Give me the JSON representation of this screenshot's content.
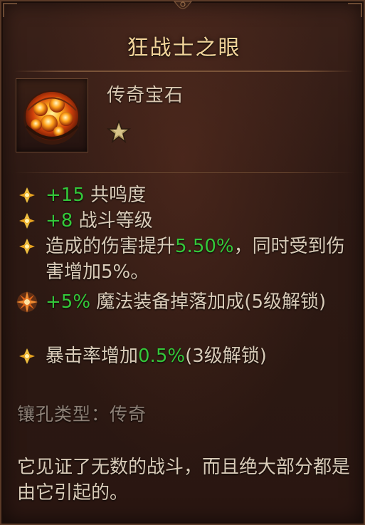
{
  "item": {
    "name": "狂战士之眼",
    "type": "传奇宝石",
    "rank_icon": "star-icon",
    "image_icon": "legendary-gem-icon"
  },
  "properties": [
    {
      "prefix": "+15",
      "text": " 共鸣度",
      "rest": "",
      "suffix": "",
      "bullet": "gold-diamond-icon"
    },
    {
      "prefix": "+8",
      "text": " 战斗等级",
      "rest": "",
      "suffix": "",
      "bullet": "gold-diamond-icon"
    },
    {
      "prefix": "",
      "text": "造成的伤害提升",
      "highlight": "5.50%",
      "rest": "，同时受到伤害增加5%。",
      "bullet": "gold-diamond-icon"
    },
    {
      "prefix": "+5%",
      "text": " 魔法装备掉落加成(5级解锁)",
      "rest": "",
      "bullet": "orange-burst-icon"
    },
    {
      "prefix": "",
      "text": "暴击率增加",
      "highlight": "0.5%",
      "rest": "(3级解锁)",
      "bullet": "gold-diamond-icon"
    }
  ],
  "socket": "镶孔类型：传奇",
  "flavor": "它见证了无数的战斗，而且绝大部分都是由它引起的。",
  "colors": {
    "title": "#f2d49a",
    "highlight": "#34c83a",
    "text": "#d9cbb8",
    "muted": "#8e8177"
  }
}
